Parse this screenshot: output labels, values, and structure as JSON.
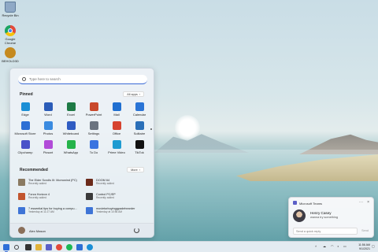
{
  "desktop": {
    "icons": [
      {
        "label": "Recycle Bin",
        "icon": "recycle-bin-icon",
        "color": "#8fa9c6"
      },
      {
        "label": "Google Chrome",
        "icon": "chrome-icon",
        "color": "#e24a3b"
      },
      {
        "label": "BEHOLD3D",
        "icon": "behold3d-icon",
        "color": "#c58a1f"
      }
    ]
  },
  "start_menu": {
    "search_placeholder": "Type here to search",
    "pinned_title": "Pinned",
    "all_apps_label": "All apps",
    "pinned": [
      {
        "label": "Edge",
        "icon": "edge-icon",
        "color": "#1b8fd6"
      },
      {
        "label": "Word",
        "icon": "word-icon",
        "color": "#2b5cb8"
      },
      {
        "label": "Excel",
        "icon": "excel-icon",
        "color": "#1e7a45"
      },
      {
        "label": "PowerPoint",
        "icon": "powerpoint-icon",
        "color": "#c9482b"
      },
      {
        "label": "Mail",
        "icon": "mail-icon",
        "color": "#1f6fd1"
      },
      {
        "label": "Calendar",
        "icon": "calendar-icon",
        "color": "#2a74d6"
      },
      {
        "label": "Microsoft Store",
        "icon": "store-icon",
        "color": "#2d6fd4"
      },
      {
        "label": "Photos",
        "icon": "photos-icon",
        "color": "#3a8be0"
      },
      {
        "label": "Whiteboard",
        "icon": "whiteboard-icon",
        "color": "#2f5cc2"
      },
      {
        "label": "Settings",
        "icon": "settings-icon",
        "color": "#6b7480"
      },
      {
        "label": "Office",
        "icon": "office-icon",
        "color": "#d6432f"
      },
      {
        "label": "Solitaire",
        "icon": "solitaire-icon",
        "color": "#2a6fb8"
      },
      {
        "label": "Clipchamp",
        "icon": "clipchamp-icon",
        "color": "#4a52c9"
      },
      {
        "label": "Picsart",
        "icon": "picsart-icon",
        "color": "#b14bd8"
      },
      {
        "label": "WhatsApp",
        "icon": "whatsapp-icon",
        "color": "#25b34a"
      },
      {
        "label": "To Do",
        "icon": "todo-icon",
        "color": "#3a74e0"
      },
      {
        "label": "Prime Video",
        "icon": "prime-video-icon",
        "color": "#1f9bd1"
      },
      {
        "label": "TikTok",
        "icon": "tiktok-icon",
        "color": "#111111"
      }
    ],
    "recommended_title": "Recommended",
    "more_label": "More",
    "recommended": [
      {
        "name": "The Elder Scrolls III: Morrowind (PC)",
        "sub": "Recently added",
        "icon": "morrowind-thumb-icon",
        "color": "#8a7a62"
      },
      {
        "name": "DOOM 64",
        "sub": "Recently added",
        "icon": "doom64-thumb-icon",
        "color": "#6b2a1a"
      },
      {
        "name": "Forza Horizon 4",
        "sub": "Recently added",
        "icon": "forza-thumb-icon",
        "color": "#c2552e"
      },
      {
        "name": "Control PC/EP",
        "sub": "Recently added",
        "icon": "control-thumb-icon",
        "color": "#3a3a3a"
      },
      {
        "name": "7 essential tips for buying a compu...",
        "sub": "Yesterday at 11:27 AM",
        "icon": "document-icon",
        "color": "#3e74d6"
      },
      {
        "name": "movietorbuyinggpadehearder",
        "sub": "Yesterday at 10:56 AM",
        "icon": "document-icon",
        "color": "#3e74d6"
      }
    ],
    "user_name": "Alex Mason"
  },
  "toast": {
    "app_name": "Microsoft Teams",
    "caller": "Henry Casey",
    "message": "wanna try something",
    "reply_placeholder": "Send a quick reply",
    "send_label": "Send"
  },
  "taskbar": {
    "apps": [
      {
        "icon": "windows-start-icon",
        "color": "#2f6fd8"
      },
      {
        "icon": "search-icon",
        "color": "#444444"
      },
      {
        "icon": "task-view-icon",
        "color": "#333333"
      },
      {
        "icon": "file-explorer-icon",
        "color": "#e0b23a"
      },
      {
        "icon": "teams-icon",
        "color": "#5b5fc7"
      },
      {
        "icon": "chrome-icon",
        "color": "#e24a3b"
      },
      {
        "icon": "spotify-icon",
        "color": "#1db954"
      },
      {
        "icon": "store-icon",
        "color": "#2d6fd4"
      },
      {
        "icon": "edge-icon",
        "color": "#1b8fd6"
      }
    ],
    "time": "11:56 AM",
    "date": "9/1/2021"
  }
}
